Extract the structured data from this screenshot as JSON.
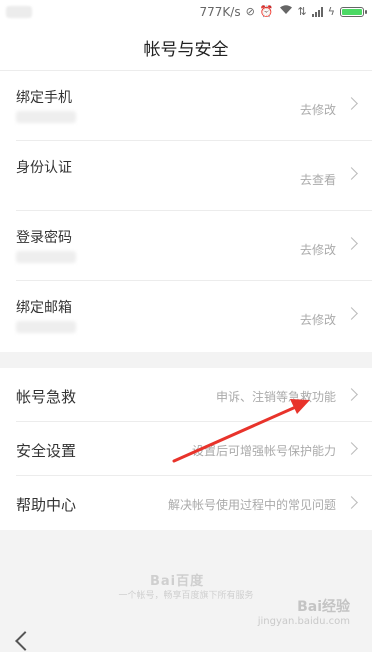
{
  "status_bar": {
    "speed": "777K/s",
    "icons": [
      "sync-off-icon",
      "alarm-icon",
      "wifi-icon",
      "signal-icon",
      "charging-icon"
    ]
  },
  "header": {
    "title": "帐号与安全"
  },
  "account_section": [
    {
      "label": "绑定手机",
      "action": "去修改"
    },
    {
      "label": "身份认证",
      "action": "去查看"
    },
    {
      "label": "登录密码",
      "action": "去修改"
    },
    {
      "label": "绑定邮箱",
      "action": "去修改"
    }
  ],
  "settings_section": [
    {
      "label": "帐号急救",
      "action": "申诉、注销等急救功能"
    },
    {
      "label": "安全设置",
      "action": "设置后可增强帐号保护能力"
    },
    {
      "label": "帮助中心",
      "action": "解决帐号使用过程中的常见问题"
    }
  ],
  "footer": {
    "logo": "Bai百度",
    "slogan": "一个帐号，畅享百度旗下所有服务",
    "watermark_main": "Bai经验",
    "watermark_sub": "jingyan.baidu.com"
  },
  "colors": {
    "battery": "#4cd964",
    "annotation_arrow": "#e8332b"
  }
}
